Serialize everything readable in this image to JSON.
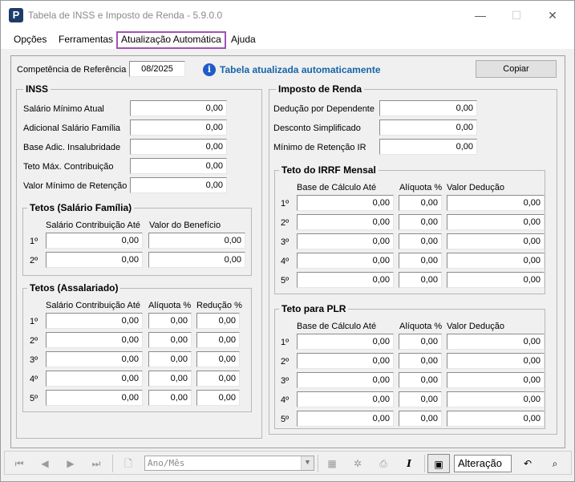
{
  "window": {
    "title": "Tabela de INSS e Imposto de Renda - 5.9.0.0",
    "app_icon_letter": "P",
    "minimize": "—",
    "maximize": "☐",
    "close": "✕"
  },
  "menu": {
    "items": [
      {
        "label": "Opções"
      },
      {
        "label": "Ferramentas"
      },
      {
        "label": "Atualização Automática"
      },
      {
        "label": "Ajuda"
      }
    ]
  },
  "header": {
    "competencia_label": "Competência de Referência",
    "competencia_value": "08/2025",
    "info_text": "Tabela atualizada automaticamente",
    "copy_button": "Copiar"
  },
  "inss": {
    "title": "INSS",
    "fields": [
      {
        "label": "Salário Mínimo Atual",
        "value": "0,00"
      },
      {
        "label": "Adicional Salário Família",
        "value": "0,00"
      },
      {
        "label": "Base Adic. Insalubridade",
        "value": "0,00"
      },
      {
        "label": "Teto Máx. Contribuição",
        "value": "0,00"
      },
      {
        "label": "Valor Mínimo de Retenção",
        "value": "0,00"
      }
    ],
    "salario_familia": {
      "title": "Tetos (Salário Família)",
      "col1": "Salário Contribuição Até",
      "col2": "Valor do Benefício",
      "rows": [
        {
          "ord": "1º",
          "a": "0,00",
          "b": "0,00"
        },
        {
          "ord": "2º",
          "a": "0,00",
          "b": "0,00"
        }
      ]
    },
    "assalariado": {
      "title": "Tetos (Assalariado)",
      "col1": "Salário Contribuição Até",
      "col2": "Alíquota %",
      "col3": "Redução %",
      "rows": [
        {
          "ord": "1º",
          "a": "0,00",
          "b": "0,00",
          "c": "0,00"
        },
        {
          "ord": "2º",
          "a": "0,00",
          "b": "0,00",
          "c": "0,00"
        },
        {
          "ord": "3º",
          "a": "0,00",
          "b": "0,00",
          "c": "0,00"
        },
        {
          "ord": "4º",
          "a": "0,00",
          "b": "0,00",
          "c": "0,00"
        },
        {
          "ord": "5º",
          "a": "0,00",
          "b": "0,00",
          "c": "0,00"
        }
      ]
    }
  },
  "ir": {
    "title": "Imposto de Renda",
    "fields": [
      {
        "label": "Dedução por Dependente",
        "value": "0,00"
      },
      {
        "label": "Desconto Simplificado",
        "value": "0,00"
      },
      {
        "label": "Mínimo de Retenção IR",
        "value": "0,00"
      }
    ],
    "irrf": {
      "title": "Teto do IRRF Mensal",
      "col1": "Base de Cálculo Até",
      "col2": "Alíquota %",
      "col3": "Valor Dedução",
      "rows": [
        {
          "ord": "1º",
          "a": "0,00",
          "b": "0,00",
          "c": "0,00"
        },
        {
          "ord": "2º",
          "a": "0,00",
          "b": "0,00",
          "c": "0,00"
        },
        {
          "ord": "3º",
          "a": "0,00",
          "b": "0,00",
          "c": "0,00"
        },
        {
          "ord": "4º",
          "a": "0,00",
          "b": "0,00",
          "c": "0,00"
        },
        {
          "ord": "5º",
          "a": "0,00",
          "b": "0,00",
          "c": "0,00"
        }
      ]
    },
    "plr": {
      "title": "Teto para PLR",
      "col1": "Base de Cálculo Até",
      "col2": "Alíquota %",
      "col3": "Valor Dedução",
      "rows": [
        {
          "ord": "1º",
          "a": "0,00",
          "b": "0,00",
          "c": "0,00"
        },
        {
          "ord": "2º",
          "a": "0,00",
          "b": "0,00",
          "c": "0,00"
        },
        {
          "ord": "3º",
          "a": "0,00",
          "b": "0,00",
          "c": "0,00"
        },
        {
          "ord": "4º",
          "a": "0,00",
          "b": "0,00",
          "c": "0,00"
        },
        {
          "ord": "5º",
          "a": "0,00",
          "b": "0,00",
          "c": "0,00"
        }
      ]
    }
  },
  "toolbar": {
    "first": "⏮",
    "prev": "◀",
    "next": "▶",
    "last": "⏭",
    "new": "🗋",
    "combo_placeholder": "Ano/Mês",
    "combo_arrow": "▼",
    "btn_a": "▦",
    "btn_b": "✲",
    "print": "⎙",
    "italic": "I",
    "save": "▣",
    "status": "Alteração",
    "undo": "↶",
    "find": "⌕"
  },
  "icons": {
    "info": "info-icon",
    "accent_menu": "#a054b0",
    "info_color": "#1565a8"
  }
}
